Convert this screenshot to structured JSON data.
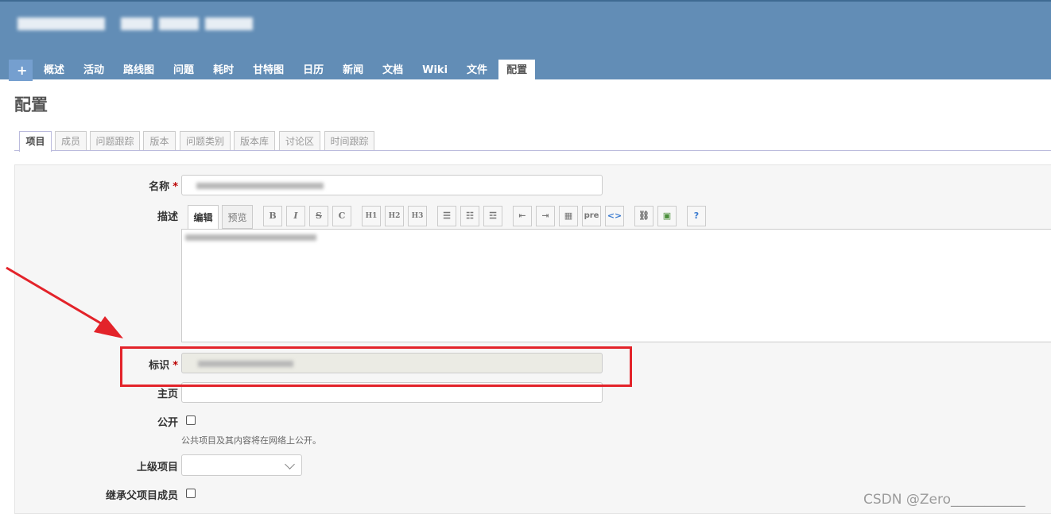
{
  "header": {
    "project_title_redacted": true,
    "menu": [
      {
        "label": "+"
      },
      {
        "label": "概述"
      },
      {
        "label": "活动"
      },
      {
        "label": "路线图"
      },
      {
        "label": "问题"
      },
      {
        "label": "耗时"
      },
      {
        "label": "甘特图"
      },
      {
        "label": "日历"
      },
      {
        "label": "新闻"
      },
      {
        "label": "文档"
      },
      {
        "label": "Wiki"
      },
      {
        "label": "文件"
      },
      {
        "label": "配置",
        "selected": true
      }
    ]
  },
  "page": {
    "title": "配置"
  },
  "tabs": [
    {
      "label": "项目",
      "selected": true
    },
    {
      "label": "成员"
    },
    {
      "label": "问题跟踪"
    },
    {
      "label": "版本"
    },
    {
      "label": "问题类别"
    },
    {
      "label": "版本库"
    },
    {
      "label": "讨论区"
    },
    {
      "label": "时间跟踪"
    }
  ],
  "form": {
    "name_label": "名称",
    "required_mark": "*",
    "description_label": "描述",
    "editor": {
      "edit_tab": "编辑",
      "preview_tab": "预览",
      "toolbar": [
        "B",
        "I",
        "S",
        "C",
        "H1",
        "H2",
        "H3",
        "ul",
        "ol",
        "task",
        "indent-left",
        "indent-right",
        "table",
        "pre",
        "code",
        "link",
        "image",
        "help"
      ]
    },
    "identifier_label": "标识",
    "homepage_label": "主页",
    "public_label": "公开",
    "public_hint": "公共项目及其内容将在网络上公开。",
    "parent_label": "上级项目",
    "inherit_label": "继承父项目成员"
  },
  "annotation": {
    "color": "#e3232a"
  },
  "watermark": "CSDN @Zero___________",
  "colors": {
    "header": "#628db6",
    "menu_plus": "#759fcf",
    "required": "#bb0000"
  }
}
